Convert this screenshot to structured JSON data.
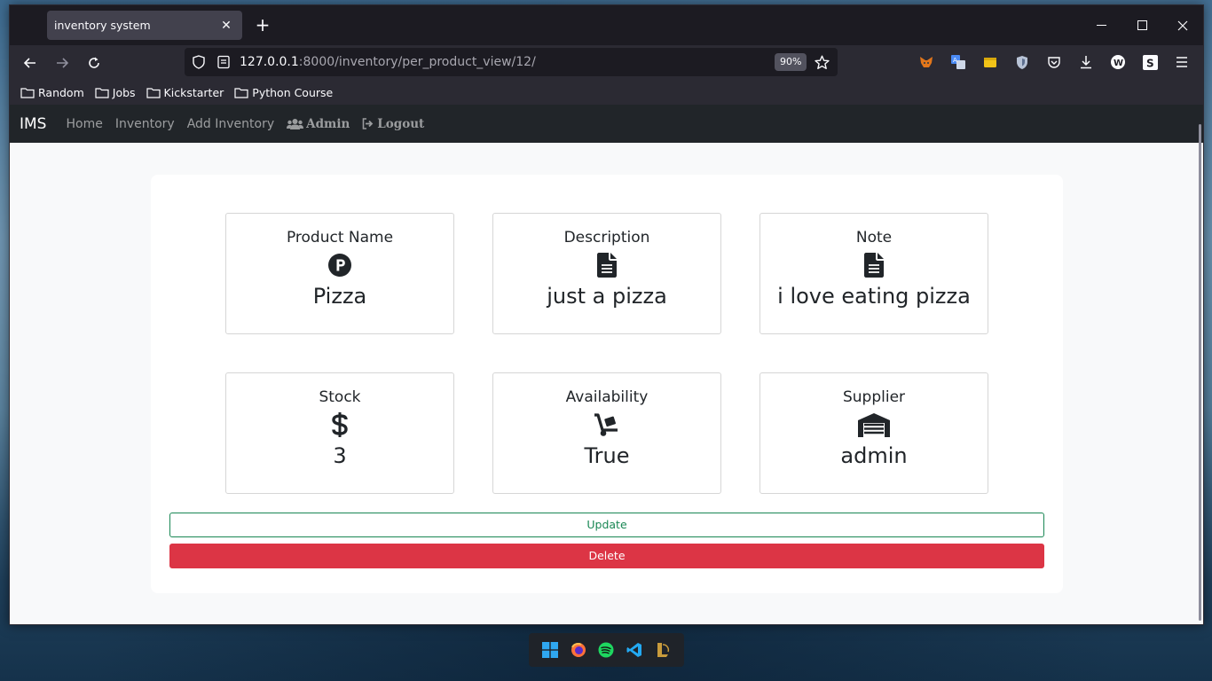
{
  "browser": {
    "tab_title": "inventory system",
    "url_host": "127.0.0.1",
    "url_rest": ":8000/inventory/per_product_view/12/",
    "zoom": "90%",
    "bookmarks": [
      "Random",
      "Jobs",
      "Kickstarter",
      "Python Course"
    ]
  },
  "app": {
    "brand": "IMS",
    "nav": [
      "Home",
      "Inventory",
      "Add Inventory"
    ],
    "admin_label": "Admin",
    "logout_label": "Logout"
  },
  "cards": [
    {
      "title": "Product Name",
      "value": "Pizza",
      "icon": "product-p-icon"
    },
    {
      "title": "Description",
      "value": "just a pizza",
      "icon": "file-text-icon"
    },
    {
      "title": "Note",
      "value": "i love eating pizza",
      "icon": "file-text-icon"
    },
    {
      "title": "Stock",
      "value": "3",
      "icon": "dollar-icon"
    },
    {
      "title": "Availability",
      "value": "True",
      "icon": "dolly-icon"
    },
    {
      "title": "Supplier",
      "value": "admin",
      "icon": "warehouse-icon"
    }
  ],
  "buttons": {
    "update": "Update",
    "delete": "Delete"
  },
  "colors": {
    "update": "#198754",
    "delete": "#dc3545",
    "navbar": "#212529"
  }
}
